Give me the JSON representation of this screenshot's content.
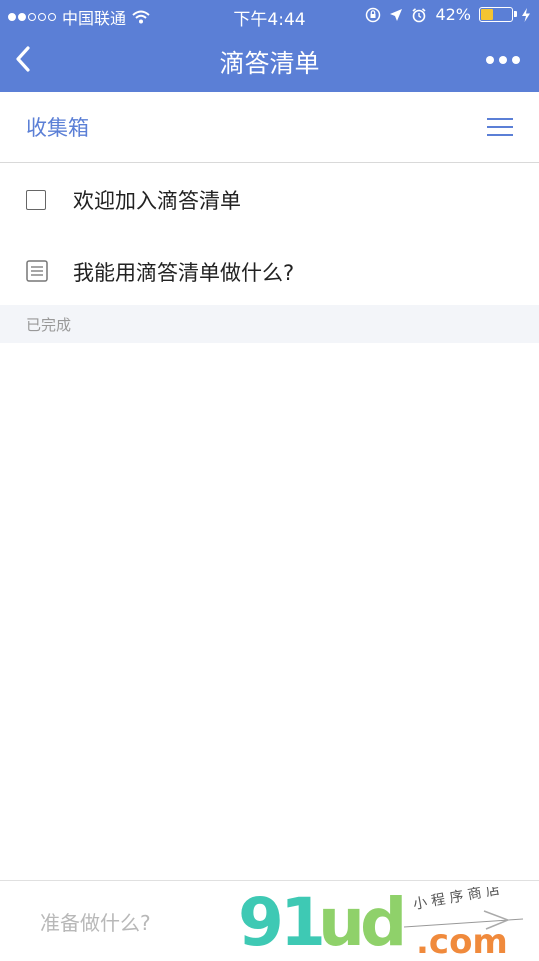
{
  "status_bar": {
    "carrier": "中国联通",
    "time": "下午4:44",
    "battery_percent": "42%",
    "battery_level": 0.42,
    "battery_color": "#f4c431"
  },
  "navbar": {
    "title": "滴答清单",
    "back_icon": "chevron-left-icon",
    "more_icon": "more-dots-icon",
    "background": "#5b7fd6"
  },
  "list": {
    "title": "收集箱",
    "menu_icon": "hamburger-icon"
  },
  "tasks": [
    {
      "label": "欢迎加入滴答清单",
      "icon": "checkbox-icon"
    },
    {
      "label": "我能用滴答清单做什么?",
      "icon": "note-icon"
    }
  ],
  "completed_section": {
    "label": "已完成"
  },
  "bottom": {
    "placeholder": "准备做什么?"
  },
  "watermark": {
    "logo": "9lud.com",
    "tagline": "小程序商店"
  }
}
